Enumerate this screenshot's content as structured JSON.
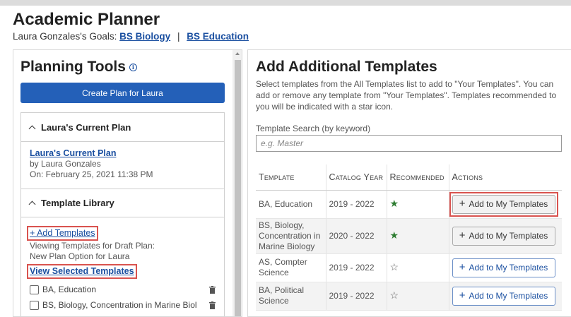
{
  "header": {
    "title": "Academic Planner",
    "goals_prefix": "Laura Gonzales's Goals:",
    "goal_1": "BS Biology",
    "goal_sep": "|",
    "goal_2": "BS Education"
  },
  "left": {
    "title": "Planning Tools",
    "info_glyph": "i",
    "create_button": "Create Plan for Laura",
    "current_plan": {
      "heading": "Laura's Current Plan",
      "link": "Laura's Current Plan",
      "by": "by Laura Gonzales",
      "on": "On: February 25, 2021 11:38 PM"
    },
    "library": {
      "heading": "Template Library",
      "add_link": "+ Add Templates",
      "viewing_line_1": "Viewing Templates for Draft Plan:",
      "viewing_line_2": "New Plan Option for Laura",
      "view_selected_link": "View Selected Templates",
      "items": [
        {
          "name": "BA, Education"
        },
        {
          "name": "BS, Biology, Concentration in Marine Biol"
        }
      ]
    }
  },
  "right": {
    "title": "Add Additional Templates",
    "description": "Select templates from the All Templates list to add to \"Your Templates\". You can add or remove any template from \"Your Templates\". Templates recommended to you will be indicated with a star icon.",
    "search_label": "Template Search (by keyword)",
    "search_placeholder": "e.g. Master",
    "columns": {
      "template": "Template",
      "catalog_year": "Catalog Year",
      "recommended": "Recommended",
      "actions": "Actions"
    },
    "action_plus": "+",
    "action_label": "Add to My Templates",
    "rows": [
      {
        "template": "BA, Education",
        "year": "2019 - 2022",
        "star": "★",
        "recommended": true
      },
      {
        "template": "BS, Biology, Concentration in Marine Biology",
        "year": "2020 - 2022",
        "star": "★",
        "recommended": true
      },
      {
        "template": "AS, Compter Science",
        "year": "2019 - 2022",
        "star": "☆",
        "recommended": false
      },
      {
        "template": "BA, Political Science",
        "year": "2019 - 2022",
        "star": "☆",
        "recommended": false
      }
    ]
  },
  "colors": {
    "primary": "#2460b8",
    "link": "#1a4fa0",
    "highlight": "#d9534f",
    "recommended_star": "#2e7d32"
  }
}
